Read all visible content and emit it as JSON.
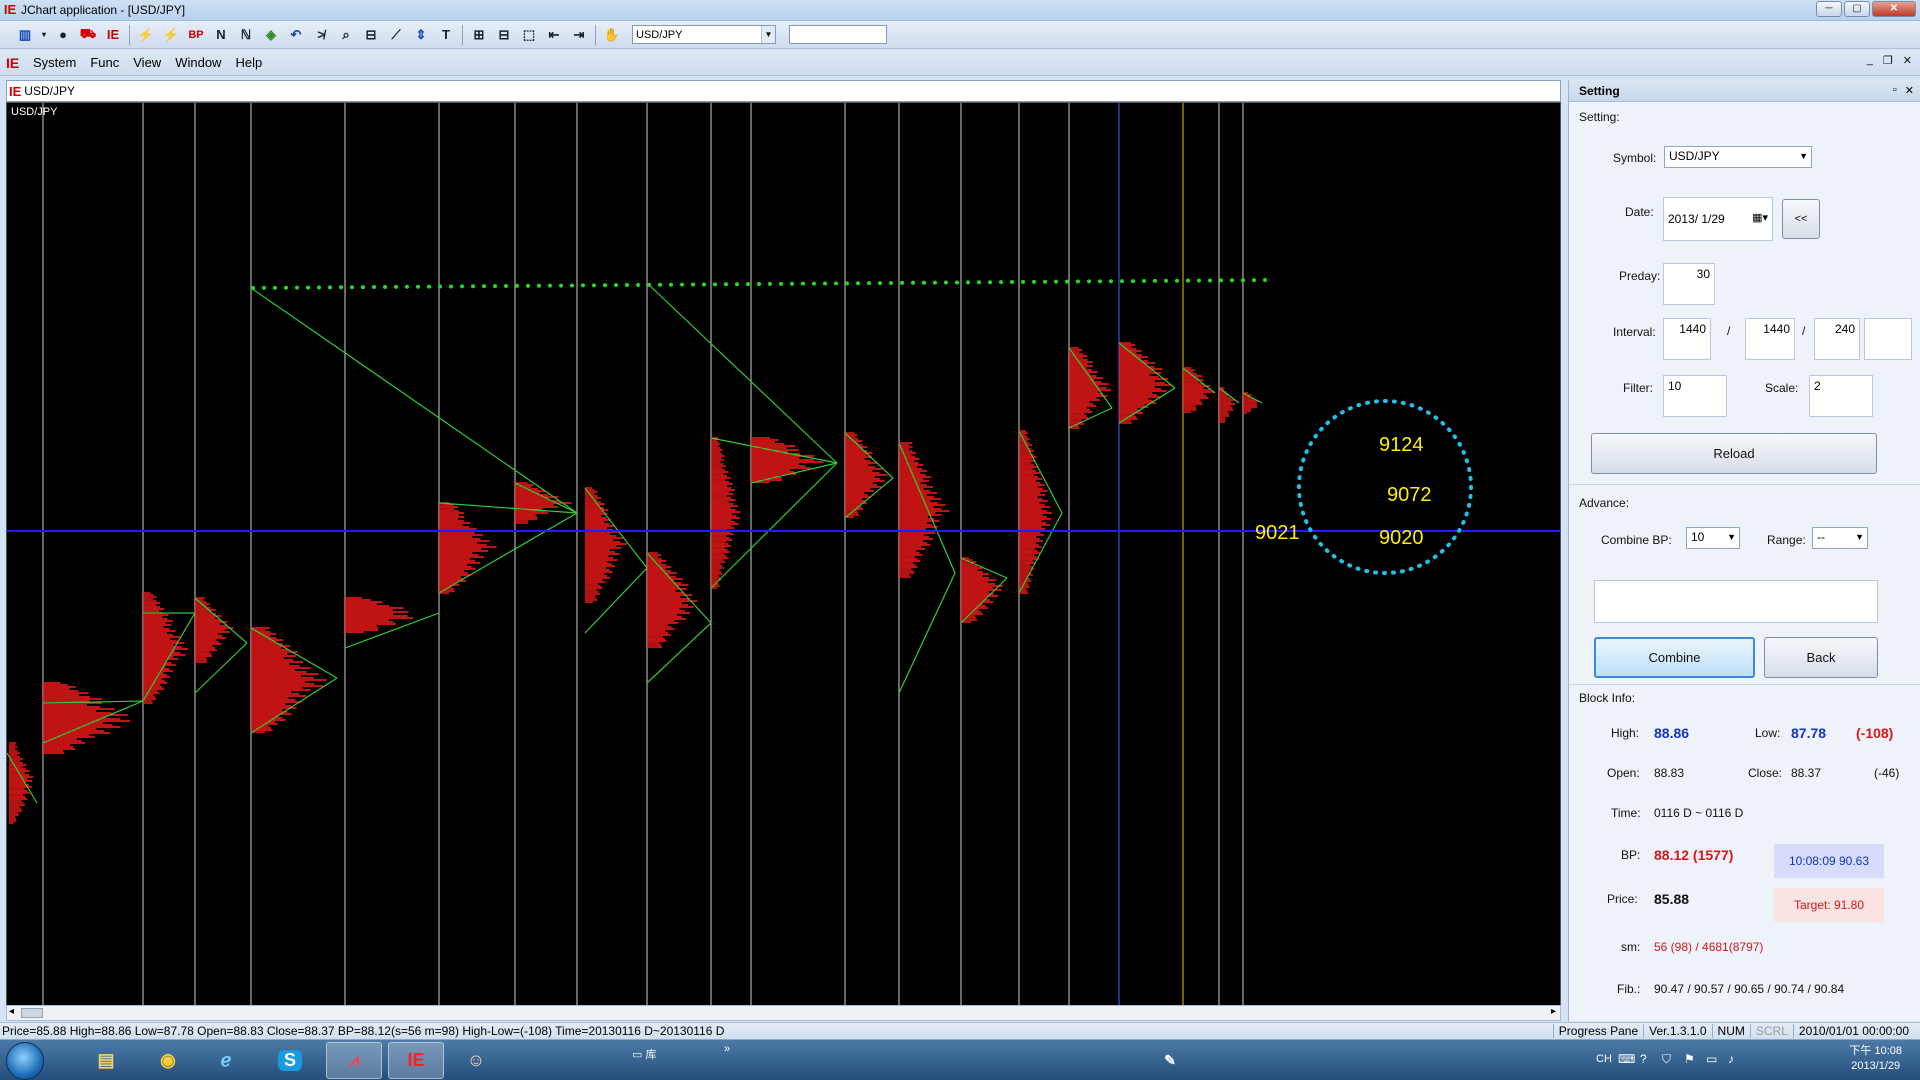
{
  "window": {
    "title": "JChart application - [USD/JPY]",
    "app_logo": "IE-logo",
    "min_label": "─",
    "max_label": "▢",
    "close_label": "✕"
  },
  "toolbar": {
    "icons": [
      "bar-chart-icon",
      "record-icon",
      "car-icon",
      "ie-logo-icon",
      "lightning-icon",
      "lightning-red-icon",
      "bp-icon",
      "n-icon",
      "n-cursor-icon",
      "cube-icon",
      "undo-icon",
      "skip-icon",
      "zoom-icon",
      "hline-icon",
      "diagonal-icon",
      "updown-icon",
      "text-icon",
      "plus-icon",
      "minus-icon",
      "select-icon",
      "left-icon",
      "right-icon",
      "hand-icon"
    ],
    "bp_label": "BP",
    "symbol_value": "USD/JPY"
  },
  "menu": {
    "items": [
      "System",
      "Func",
      "View",
      "Window",
      "Help"
    ],
    "mdi_min": "_",
    "mdi_restore": "❐",
    "mdi_close": "✕"
  },
  "chart": {
    "tab_label": "USD/JPY",
    "symbol_label": "USD/JPY",
    "labels": {
      "a": "9124",
      "b": "9072",
      "c": "9021",
      "d": "9020"
    },
    "colors": {
      "background": "#000000",
      "profile": "#ff1a1a",
      "trend": "#33cc33",
      "dotted": "#22dd22",
      "level": "#1e1eff",
      "circle": "#22bfe6",
      "label": "#ffee00",
      "grid": "#cfcfcf"
    }
  },
  "chart_data": {
    "type": "volume-profile",
    "symbol": "USD/JPY",
    "annotated_levels": [
      "9124",
      "9072",
      "9021",
      "9020"
    ]
  },
  "panel": {
    "header": "Setting",
    "section_setting": "Setting:",
    "symbol_label": "Symbol:",
    "symbol_value": "USD/JPY",
    "date_label": "Date:",
    "date_value": "2013/  1/29",
    "back_nav": "<<",
    "preday_label": "Preday:",
    "preday_value": "30",
    "interval_label": "Interval:",
    "interval_1": "1440",
    "interval_sep1": "/",
    "interval_2": "1440",
    "interval_sep2": "/",
    "interval_3": "240",
    "interval_4": "",
    "filter_label": "Filter:",
    "filter_value": "10",
    "scale_label": "Scale:",
    "scale_value": "2",
    "reload": "Reload",
    "section_advance": "Advance:",
    "combine_bp_label": "Combine BP:",
    "combine_bp_value": "10",
    "range_label": "Range:",
    "range_value": "--",
    "note_value": "",
    "combine": "Combine",
    "back": "Back",
    "section_block": "Block Info:",
    "high_label": "High:",
    "high_value": "88.86",
    "low_label": "Low:",
    "low_value": "87.78",
    "low_diff": "(-108)",
    "open_label": "Open:",
    "open_value": "88.83",
    "close_label": "Close:",
    "close_value": "88.37",
    "close_diff": "(-46)",
    "time_label": "Time:",
    "time_value": "0116 D ~ 0116 D",
    "bp_label": "BP:",
    "bp_value": "88.12 (1577)",
    "clock_value": "10:08:09  90.63",
    "price_label": "Price:",
    "price_value": "85.88",
    "target_value": "Target: 91.80",
    "sm_label": "sm:",
    "sm_value": "56 (98) / 4681(8797)",
    "fib_label": "Fib.:",
    "fib_value": "90.47 / 90.57 / 90.65 / 90.74 / 90.84"
  },
  "status": {
    "left": "Price=85.88   High=88.86   Low=87.78   Open=88.83   Close=88.37   BP=88.12(s=56 m=98)   High-Low=(-108)   Time=20130116 D~20130116 D",
    "progress": "Progress Pane",
    "version": "Ver.1.3.1.0",
    "num": "NUM",
    "scrl": "SCRL",
    "datetime": "2010/01/01 00:00:00"
  },
  "taskbar": {
    "apps": [
      "explorer-icon",
      "chrome-icon",
      "ie-icon",
      "skype-icon",
      "chart-app-icon",
      "ie-logo-app-icon",
      "users-icon"
    ],
    "folder_label": "库",
    "more": "»",
    "lang": "CH",
    "time": "下午 10:08",
    "date": "2013/1/29"
  }
}
